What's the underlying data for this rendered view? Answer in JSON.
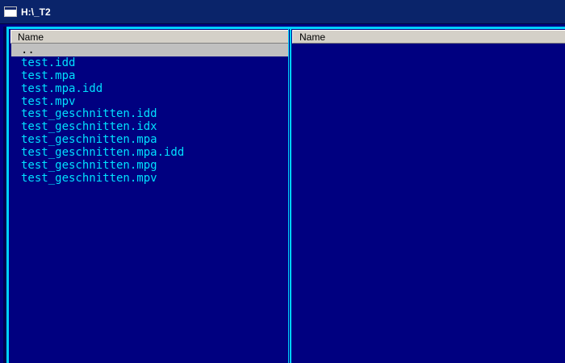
{
  "window": {
    "title": "H:\\_T2"
  },
  "left_panel": {
    "column_header": "Name",
    "files": [
      {
        "name": "..",
        "selected": true
      },
      {
        "name": "test.idd",
        "selected": false
      },
      {
        "name": "test.mpa",
        "selected": false
      },
      {
        "name": "test.mpa.idd",
        "selected": false
      },
      {
        "name": "test.mpv",
        "selected": false
      },
      {
        "name": "test_geschnitten.idd",
        "selected": false
      },
      {
        "name": "test_geschnitten.idx",
        "selected": false
      },
      {
        "name": "test_geschnitten.mpa",
        "selected": false
      },
      {
        "name": "test_geschnitten.mpa.idd",
        "selected": false
      },
      {
        "name": "test_geschnitten.mpg",
        "selected": false
      },
      {
        "name": "test_geschnitten.mpv",
        "selected": false
      }
    ]
  },
  "right_panel": {
    "column_header": "Name",
    "files": []
  },
  "colors": {
    "background": "#000080",
    "title_bar": "#0a246a",
    "file_text": "#00e0ff",
    "frame": "#00d0ff",
    "selection": "#c0c0c0",
    "header": "#d4d0c8"
  }
}
